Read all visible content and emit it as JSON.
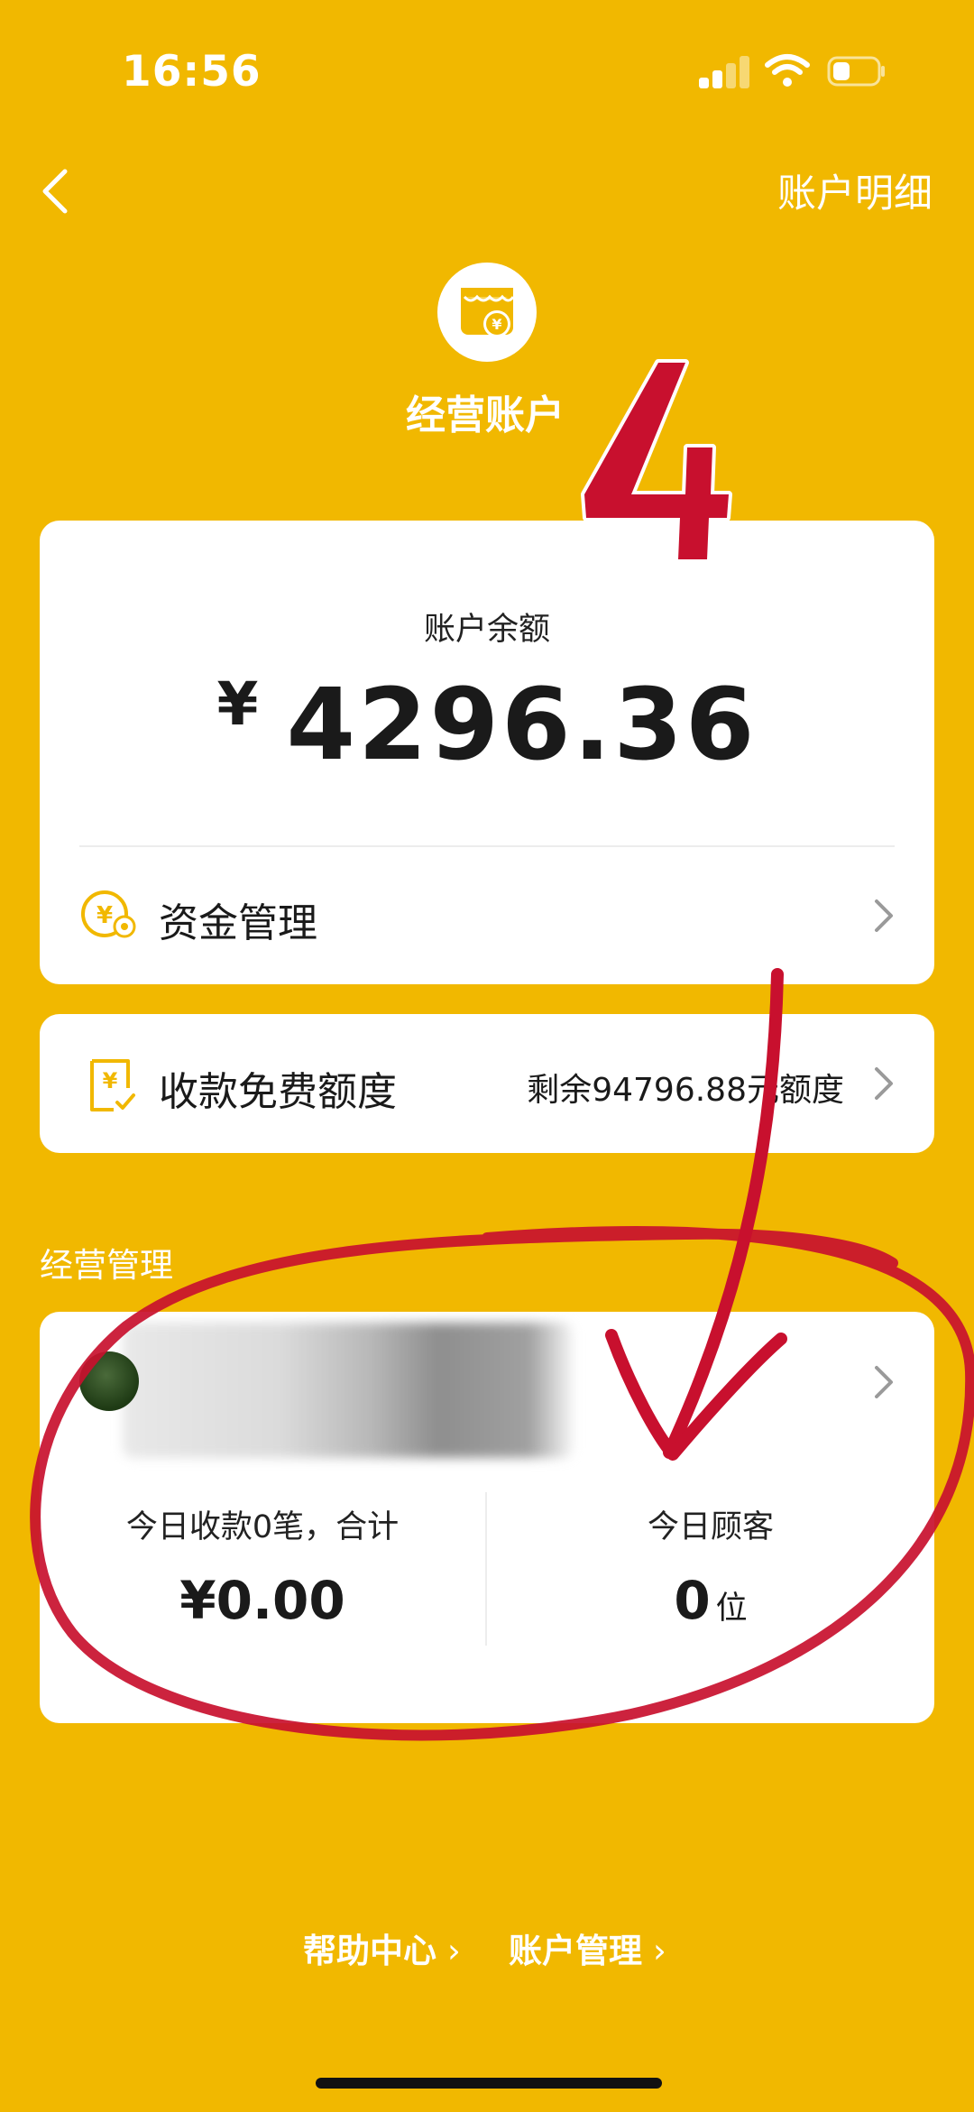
{
  "status_bar": {
    "time": "16:56"
  },
  "nav": {
    "detail_link": "账户明细"
  },
  "header": {
    "title": "经营账户"
  },
  "annotation": {
    "number": "4",
    "color": "#C8102E"
  },
  "balance_card": {
    "label": "账户余额",
    "currency": "¥",
    "amount": "4296.36",
    "fund_management": "资金管理"
  },
  "quota_card": {
    "label": "收款免费额度",
    "remaining": "剩余94796.88元额度"
  },
  "management": {
    "section_title": "经营管理",
    "today_payments_label": "今日收款0笔，合计",
    "today_payments_value": "¥0.00",
    "today_customers_label": "今日顾客",
    "today_customers_value": "0",
    "today_customers_unit": "位"
  },
  "footer": {
    "help_center": "帮助中心",
    "account_management": "账户管理"
  },
  "colors": {
    "background": "#F1B800",
    "accent": "#F1B800",
    "card": "#FFFFFF"
  }
}
